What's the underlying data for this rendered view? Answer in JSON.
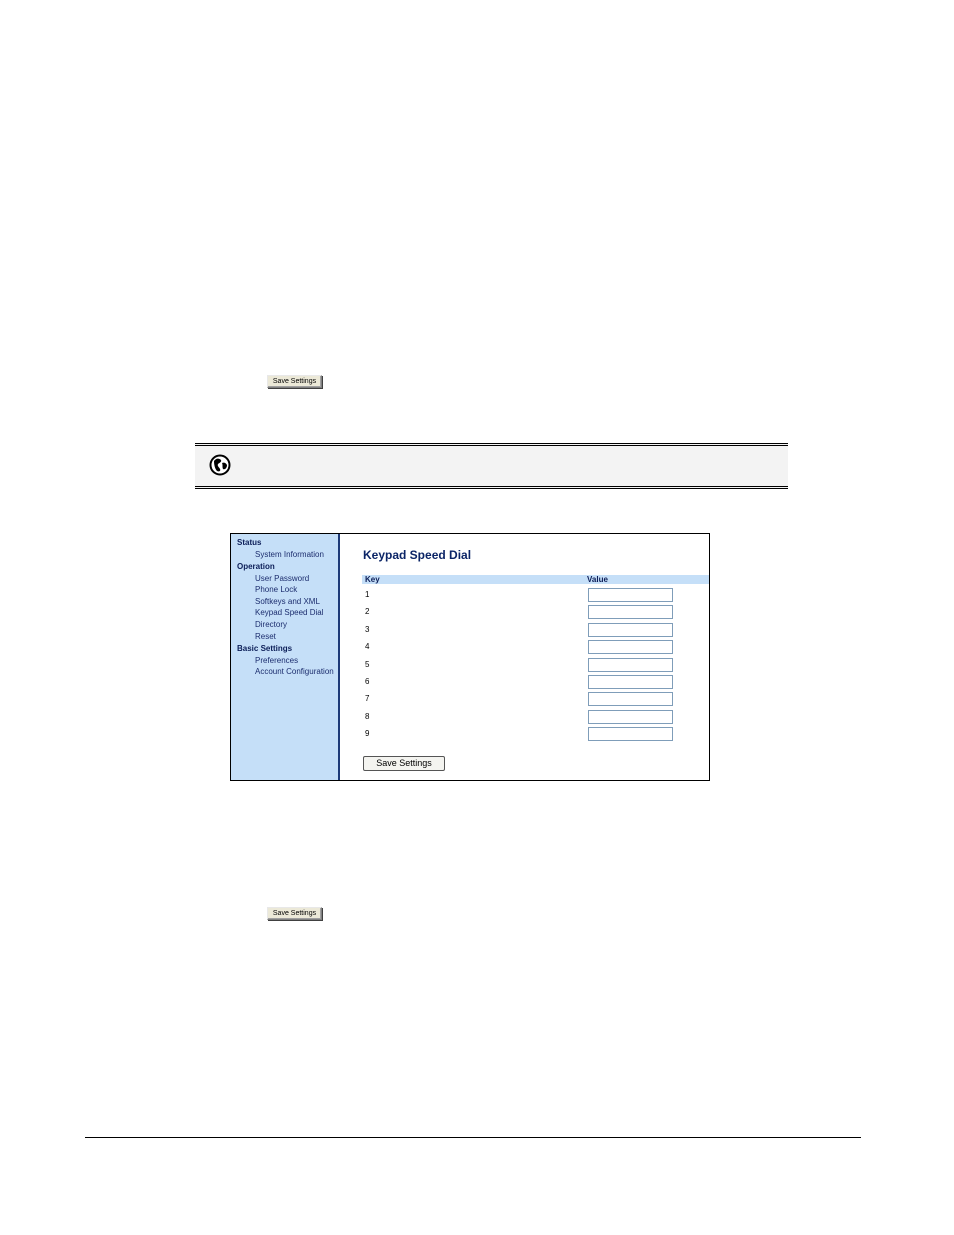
{
  "top_save_button_label": "Save Settings",
  "bottom_save_button_label": "Save Settings",
  "screenshot": {
    "title": "Keypad Speed Dial",
    "sidebar": {
      "status_header": "Status",
      "system_information": "System Information",
      "operation_header": "Operation",
      "user_password": "User Password",
      "phone_lock": "Phone Lock",
      "softkeys_xml": "Softkeys and XML",
      "keypad_speed_dial": "Keypad Speed Dial",
      "directory": "Directory",
      "reset": "Reset",
      "basic_settings_header": "Basic Settings",
      "preferences": "Preferences",
      "account_configuration": "Account Configuration"
    },
    "table": {
      "col_key": "Key",
      "col_value": "Value",
      "keys": [
        "1",
        "2",
        "3",
        "4",
        "5",
        "6",
        "7",
        "8",
        "9"
      ],
      "values": [
        "",
        "",
        "",
        "",
        "",
        "",
        "",
        "",
        ""
      ]
    },
    "save_label": "Save Settings"
  },
  "colors": {
    "sidebar_bg": "#c5dff8",
    "title_color": "#0b2466",
    "sidebar_border": "#1e3a78"
  }
}
